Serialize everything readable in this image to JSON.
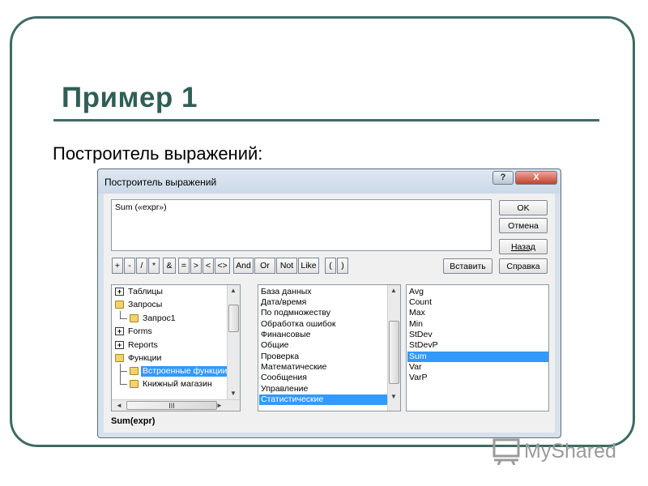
{
  "slide": {
    "title": "Пример 1",
    "subtitle": "Построитель выражений:",
    "watermark": "MyShared"
  },
  "dialog": {
    "title": "Построитель выражений",
    "help_button": "?",
    "close_button": "X",
    "expression": "Sum («expr»)",
    "buttons": {
      "ok": "OK",
      "cancel": "Отмена",
      "back": "Назад",
      "insert": "Вставить",
      "help": "Справка"
    },
    "operators": [
      "+",
      "-",
      "/",
      "*",
      "&",
      "=",
      ">",
      "<",
      "<>",
      "And",
      "Or",
      "Not",
      "Like",
      "(",
      ")"
    ],
    "tree": [
      {
        "label": "Таблицы",
        "icon": "plus-box-folder-icon"
      },
      {
        "label": "Запросы",
        "icon": "folder-open-icon"
      },
      {
        "label": "Запрос1",
        "icon": "folder-icon"
      },
      {
        "label": "Forms",
        "icon": "plus-box-folder-icon"
      },
      {
        "label": "Reports",
        "icon": "plus-box-folder-icon"
      },
      {
        "label": "Функции",
        "icon": "folder-open-icon"
      },
      {
        "label": "Встроенные функции",
        "icon": "folder-open-icon",
        "selected": true
      },
      {
        "label": "Книжный магазин",
        "icon": "folder-icon"
      }
    ],
    "tree_hscroll_thumb": "III",
    "categories": [
      {
        "label": "База данных"
      },
      {
        "label": "Дата/время"
      },
      {
        "label": "По подмножеству"
      },
      {
        "label": "Обработка ошибок"
      },
      {
        "label": "Финансовые"
      },
      {
        "label": "Общие"
      },
      {
        "label": "Проверка"
      },
      {
        "label": "Математические"
      },
      {
        "label": "Сообщения"
      },
      {
        "label": "Управление"
      },
      {
        "label": "Статистические",
        "selected": true
      }
    ],
    "functions": [
      {
        "label": "Avg"
      },
      {
        "label": "Count"
      },
      {
        "label": "Max"
      },
      {
        "label": "Min"
      },
      {
        "label": "StDev"
      },
      {
        "label": "StDevP"
      },
      {
        "label": "Sum",
        "selected": true
      },
      {
        "label": "Var"
      },
      {
        "label": "VarP"
      }
    ],
    "status": "Sum(expr)"
  },
  "colors": {
    "accent": "#3d6b63",
    "title": "#2f5e55",
    "selection": "#3399ff",
    "dialog_frame": "#d7e1ec",
    "close_button": "#c4402c"
  }
}
